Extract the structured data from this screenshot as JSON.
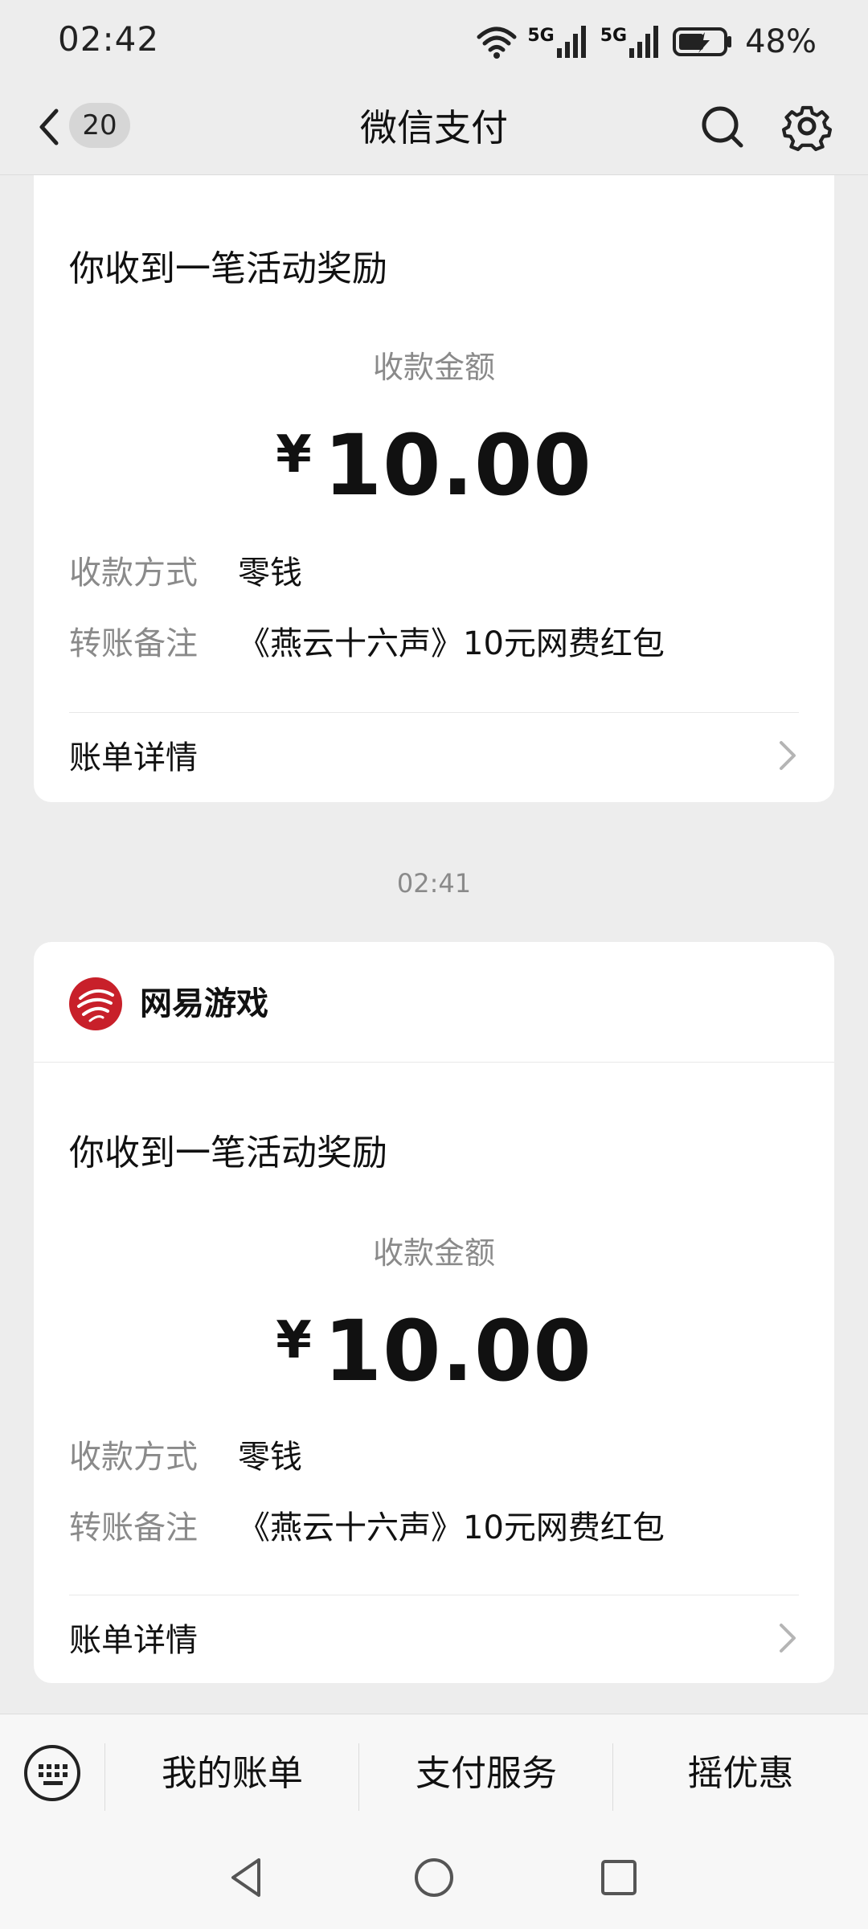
{
  "status_bar": {
    "time": "02:42",
    "network_1": "5G",
    "network_2": "5G",
    "battery": "48%"
  },
  "nav": {
    "unread_count": "20",
    "title": "微信支付",
    "icons": [
      "back-icon",
      "search-icon",
      "gear-icon"
    ]
  },
  "cards": [
    {
      "title": "你收到一笔活动奖励",
      "amount_label": "收款金额",
      "currency": "¥",
      "amount": "10.00",
      "method_label": "收款方式",
      "method_value": "零钱",
      "note_label": "转账备注",
      "note_value": "《燕云十六声》10元网费红包",
      "detail_label": "账单详情"
    },
    {
      "sender": "网易游戏",
      "title": "你收到一笔活动奖励",
      "amount_label": "收款金额",
      "currency": "¥",
      "amount": "10.00",
      "method_label": "收款方式",
      "method_value": "零钱",
      "note_label": "转账备注",
      "note_value": "《燕云十六声》10元网费红包",
      "detail_label": "账单详情"
    }
  ],
  "time_divider": "02:41",
  "bottom_menu": {
    "items": [
      "我的账单",
      "支付服务",
      "摇优惠"
    ]
  },
  "colors": {
    "background": "#ededed",
    "card": "#ffffff",
    "secondary_text": "#8a8a8a",
    "brand_red": "#c8202a"
  }
}
